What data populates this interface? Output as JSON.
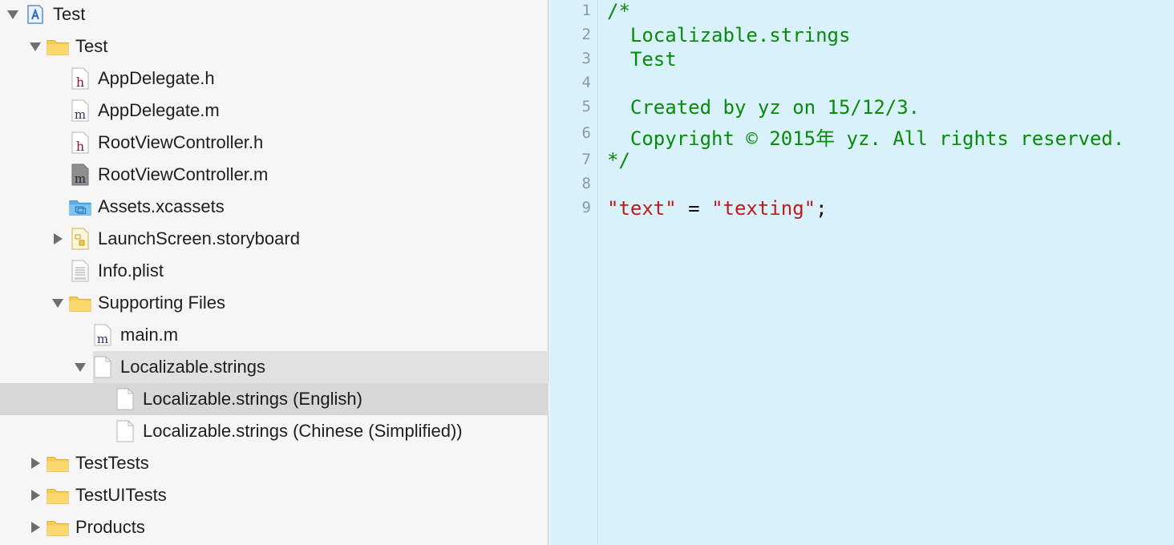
{
  "navigator": {
    "rows": [
      {
        "label": "Test",
        "icon": "xcode-project-icon",
        "disclosure": "open"
      },
      {
        "label": "Test",
        "icon": "folder-icon",
        "disclosure": "open"
      },
      {
        "label": "AppDelegate.h",
        "icon": "header-file-icon",
        "disclosure": "none"
      },
      {
        "label": "AppDelegate.m",
        "icon": "objc-file-icon",
        "disclosure": "none"
      },
      {
        "label": "RootViewController.h",
        "icon": "header-file-icon",
        "disclosure": "none"
      },
      {
        "label": "RootViewController.m",
        "icon": "objc-file-icon",
        "disclosure": "none"
      },
      {
        "label": "Assets.xcassets",
        "icon": "asset-catalog-icon",
        "disclosure": "none"
      },
      {
        "label": "LaunchScreen.storyboard",
        "icon": "storyboard-icon",
        "disclosure": "closed"
      },
      {
        "label": "Info.plist",
        "icon": "plist-file-icon",
        "disclosure": "none"
      },
      {
        "label": "Supporting Files",
        "icon": "folder-icon",
        "disclosure": "open"
      },
      {
        "label": "main.m",
        "icon": "objc-file-icon",
        "disclosure": "none"
      },
      {
        "label": "Localizable.strings",
        "icon": "blank-file-icon",
        "disclosure": "open"
      },
      {
        "label": "Localizable.strings (English)",
        "icon": "blank-file-icon",
        "disclosure": "none"
      },
      {
        "label": "Localizable.strings (Chinese (Simplified))",
        "icon": "blank-file-icon",
        "disclosure": "none"
      },
      {
        "label": "TestTests",
        "icon": "folder-icon",
        "disclosure": "closed"
      },
      {
        "label": "TestUITests",
        "icon": "folder-icon",
        "disclosure": "closed"
      },
      {
        "label": "Products",
        "icon": "folder-icon",
        "disclosure": "closed"
      }
    ],
    "selected_label": "Localizable.strings (English)"
  },
  "editor": {
    "line_numbers": [
      "1",
      "2",
      "3",
      "4",
      "5",
      "6",
      "7",
      "8",
      "9"
    ],
    "lines": [
      {
        "tokens": [
          {
            "t": "/*",
            "k": "cmt"
          }
        ]
      },
      {
        "tokens": [
          {
            "t": "  Localizable.strings",
            "k": "cmt"
          }
        ]
      },
      {
        "tokens": [
          {
            "t": "  Test",
            "k": "cmt"
          }
        ]
      },
      {
        "tokens": []
      },
      {
        "tokens": [
          {
            "t": "  Created by yz on 15/12/3.",
            "k": "cmt"
          }
        ]
      },
      {
        "tokens": [
          {
            "t": "  Copyright © 2015年 yz. All rights reserved.",
            "k": "cmt"
          }
        ]
      },
      {
        "tokens": [
          {
            "t": "*/",
            "k": "cmt"
          }
        ]
      },
      {
        "tokens": []
      },
      {
        "tokens": [
          {
            "t": "\"text\"",
            "k": "str"
          },
          {
            "t": " = ",
            "k": "plain"
          },
          {
            "t": "\"texting\"",
            "k": "str"
          },
          {
            "t": ";",
            "k": "plain"
          }
        ]
      }
    ]
  },
  "colors": {
    "editor_background": "#d8f1fb",
    "comment": "#0a8a0a",
    "string": "#c01a1a",
    "selection": "#d7d7d7"
  }
}
